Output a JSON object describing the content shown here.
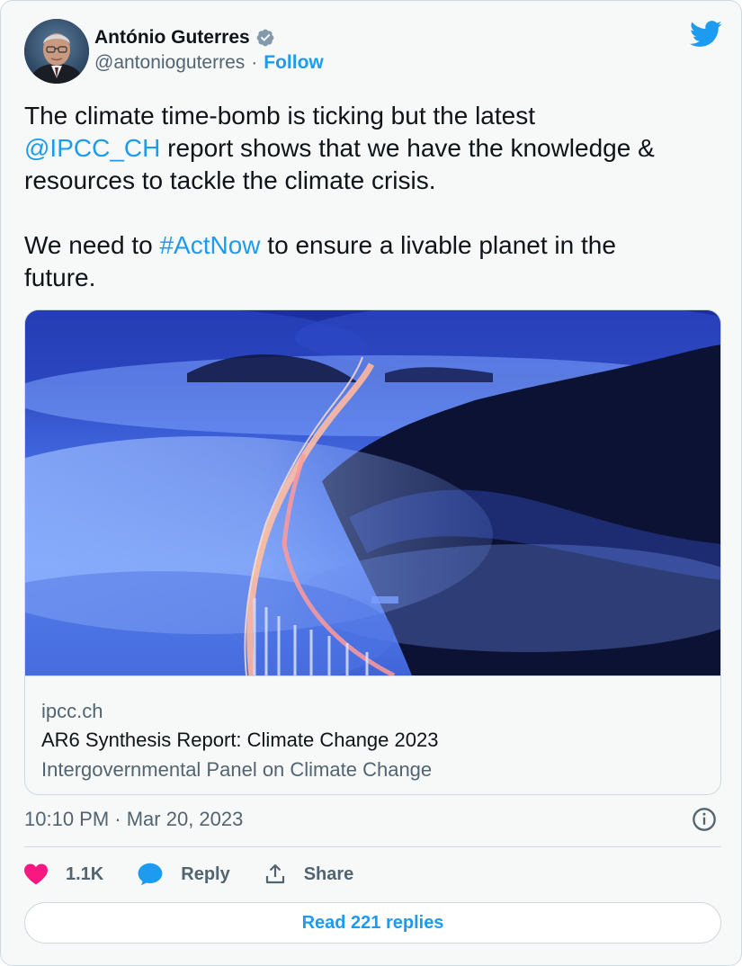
{
  "author": {
    "display_name": "António Guterres",
    "handle": "@antonioguterres",
    "separator": "·",
    "follow_label": "Follow"
  },
  "tweet": {
    "line1_prefix": "The climate time-bomb is ticking but the latest",
    "mention": "@IPCC_CH",
    "line2_suffix": " report shows that we have the knowledge &",
    "line3": "resources to tackle the climate crisis.",
    "para2_prefix": "We need to ",
    "hashtag": "#ActNow",
    "para2_suffix": " to ensure a livable planet in the",
    "para2_line2": "future."
  },
  "link_card": {
    "domain": "ipcc.ch",
    "title": "AR6 Synthesis Report: Climate Change 2023",
    "description": "Intergovernmental Panel on Climate Change"
  },
  "timestamp": "10:10 PM · Mar 20, 2023",
  "actions": {
    "like_count": "1.1K",
    "reply_label": "Reply",
    "share_label": "Share"
  },
  "read_replies_label": "Read 221 replies",
  "colors": {
    "accent": "#1d9bf0",
    "like": "#f91880",
    "muted": "#536471",
    "verified": "#829aab"
  },
  "icons": {
    "brand": "twitter-bird-icon",
    "verified": "verified-badge-icon",
    "info": "info-icon",
    "like": "heart-icon",
    "reply": "speech-bubble-icon",
    "share": "share-upload-icon"
  }
}
